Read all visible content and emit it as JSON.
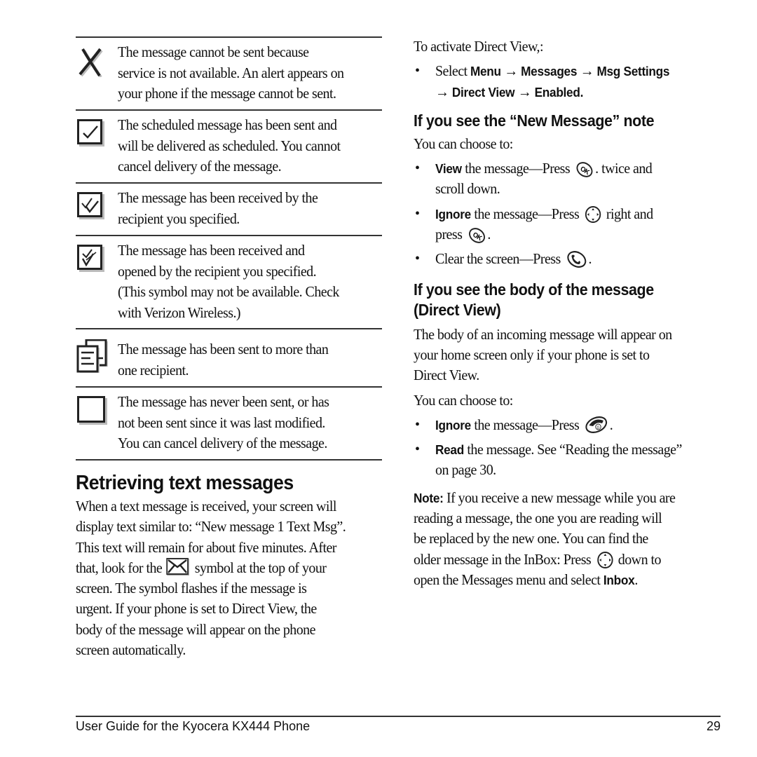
{
  "status_table": [
    {
      "icon": "x-icon",
      "lines": [
        "The message cannot be sent because",
        "service is not available. An alert appears on",
        "your phone if the message cannot be sent."
      ]
    },
    {
      "icon": "checkbox-single-check-icon",
      "lines": [
        "The scheduled message has been sent and",
        "will be delivered as scheduled. You cannot",
        "cancel delivery of the message."
      ]
    },
    {
      "icon": "checkbox-double-check-icon",
      "lines": [
        "The message has been received by the",
        "recipient you specified."
      ]
    },
    {
      "icon": "checkbox-opened-check-icon",
      "lines": [
        "The message has been received and",
        "opened by the recipient you specified.",
        "(This symbol may not be available. Check",
        "with Verizon Wireless.)"
      ]
    },
    {
      "icon": "multiple-documents-icon",
      "lines": [
        "The message has been sent to more than",
        "one recipient."
      ]
    },
    {
      "icon": "empty-box-icon",
      "lines": [
        "The message has never been sent, or has",
        "not been sent since it was last modified.",
        "You can cancel delivery of the message."
      ]
    }
  ],
  "retrieving": {
    "title": "Retrieving text messages",
    "lines": [
      "When a text message is received, your screen will",
      "display text similar to: “New message 1 Text Msg”.",
      "This text will remain for about five minutes. After"
    ],
    "line4_before": "that, look for the",
    "line4_icon": "envelope-icon",
    "line4_after": "symbol at the top of your",
    "lines_after": [
      "screen. The symbol flashes if the message is",
      "urgent. If your phone is set to Direct View, the",
      "body of the message will appear on the phone",
      "screen automatically."
    ]
  },
  "activate": {
    "intro": "To activate Direct View,:",
    "select_word": "Select",
    "path1": [
      "Menu",
      "Messages",
      "Msg Settings"
    ],
    "path2": [
      "Direct View",
      "Enabled"
    ],
    "arrow": "→",
    "end": "."
  },
  "new_message": {
    "heading": "If you see the “New Message” note",
    "choose": "You can choose to:",
    "bullets": [
      {
        "bold": "View",
        "text": " the message—Press",
        "icon": "ok-key-icon",
        "after": ". twice and",
        "line2": "scroll down."
      },
      {
        "bold": "Ignore",
        "text": " the message—Press",
        "icon": "nav-key-icon",
        "after": "right and",
        "line2_before": "press",
        "line2_icon": "ok-key-icon",
        "line2_after": "."
      },
      {
        "text": "Clear the screen—Press",
        "icon": "send-key-icon",
        "after": "."
      }
    ]
  },
  "direct_view": {
    "heading_lines": [
      "If you see the body of the message",
      "(Direct View)"
    ],
    "body_lines": [
      "The body of an incoming message will appear on",
      "your home screen only if your phone is set to",
      "Direct View."
    ],
    "choose": "You can choose to:",
    "bullets": [
      {
        "bold": "Ignore",
        "text": " the message—Press",
        "icon": "end-key-icon",
        "after": "."
      },
      {
        "bold": "Read",
        "text": " the message. See “Reading the message”",
        "line2": "on page 30."
      }
    ]
  },
  "note": {
    "label": "Note:",
    "line1": "If you receive a new message while you are",
    "line2": "reading a message, the one you are reading will",
    "line3": "be replaced by the new one. You can find the",
    "line4_before": "older message in the InBox: Press",
    "line4_icon": "nav-key-icon",
    "line4_after": "down to",
    "line5_before": "open the Messages menu and select",
    "line5_bold": "Inbox",
    "line5_end": "."
  },
  "footer": {
    "title": "User Guide for the Kyocera KX444 Phone",
    "page": "29"
  }
}
